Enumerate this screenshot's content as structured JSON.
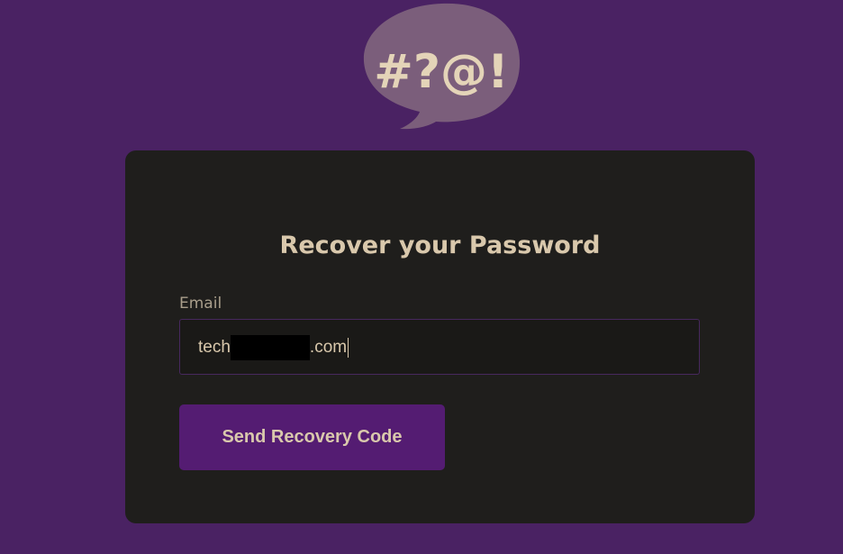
{
  "logo": {
    "text": "#?@!",
    "bubble_color": "#7b5e7b",
    "text_color": "#e4d4b8",
    "icon": "speech-bubble-icon"
  },
  "colors": {
    "page_background": "#4a2263",
    "card_background": "#1f1e1c",
    "accent": "#541c72",
    "text": "#d9c8ac"
  },
  "form": {
    "title": "Recover your Password",
    "email_label": "Email",
    "email_value_start": "tech",
    "email_value_end": ".com",
    "submit_label": "Send Recovery Code"
  }
}
